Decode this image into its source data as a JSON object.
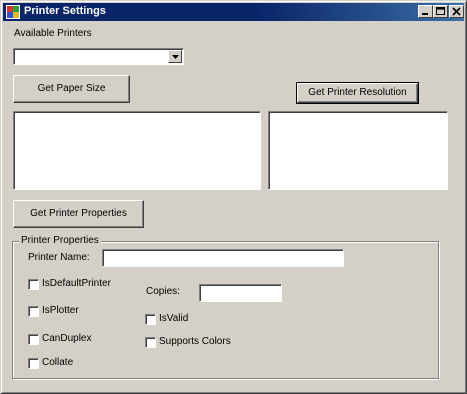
{
  "window": {
    "title": "Printer Settings",
    "icons": {
      "app": "printer-app-icon",
      "minimize": "minimize-icon",
      "maximize": "maximize-icon",
      "close": "close-icon"
    }
  },
  "printers": {
    "label": "Available Printers",
    "selected": ""
  },
  "buttons": {
    "paper_size": "Get Paper Size",
    "resolution": "Get Printer Resolution",
    "properties": "Get Printer Properties"
  },
  "properties_group": {
    "title": "Printer Properties",
    "printer_name_label": "Printer Name:",
    "printer_name_value": "",
    "copies_label": "Copies:",
    "copies_value": "",
    "checkboxes": [
      {
        "label": "IsDefaultPrinter",
        "checked": false
      },
      {
        "label": "IsPlotter",
        "checked": false
      },
      {
        "label": "CanDuplex",
        "checked": false
      },
      {
        "label": "Collate",
        "checked": false
      },
      {
        "label": "IsValid",
        "checked": false
      },
      {
        "label": "Supports Colors",
        "checked": false
      }
    ]
  },
  "colors": {
    "titlebar_start": "#0a246a",
    "titlebar_end": "#3a6ea5",
    "face": "#d4d0c8"
  }
}
